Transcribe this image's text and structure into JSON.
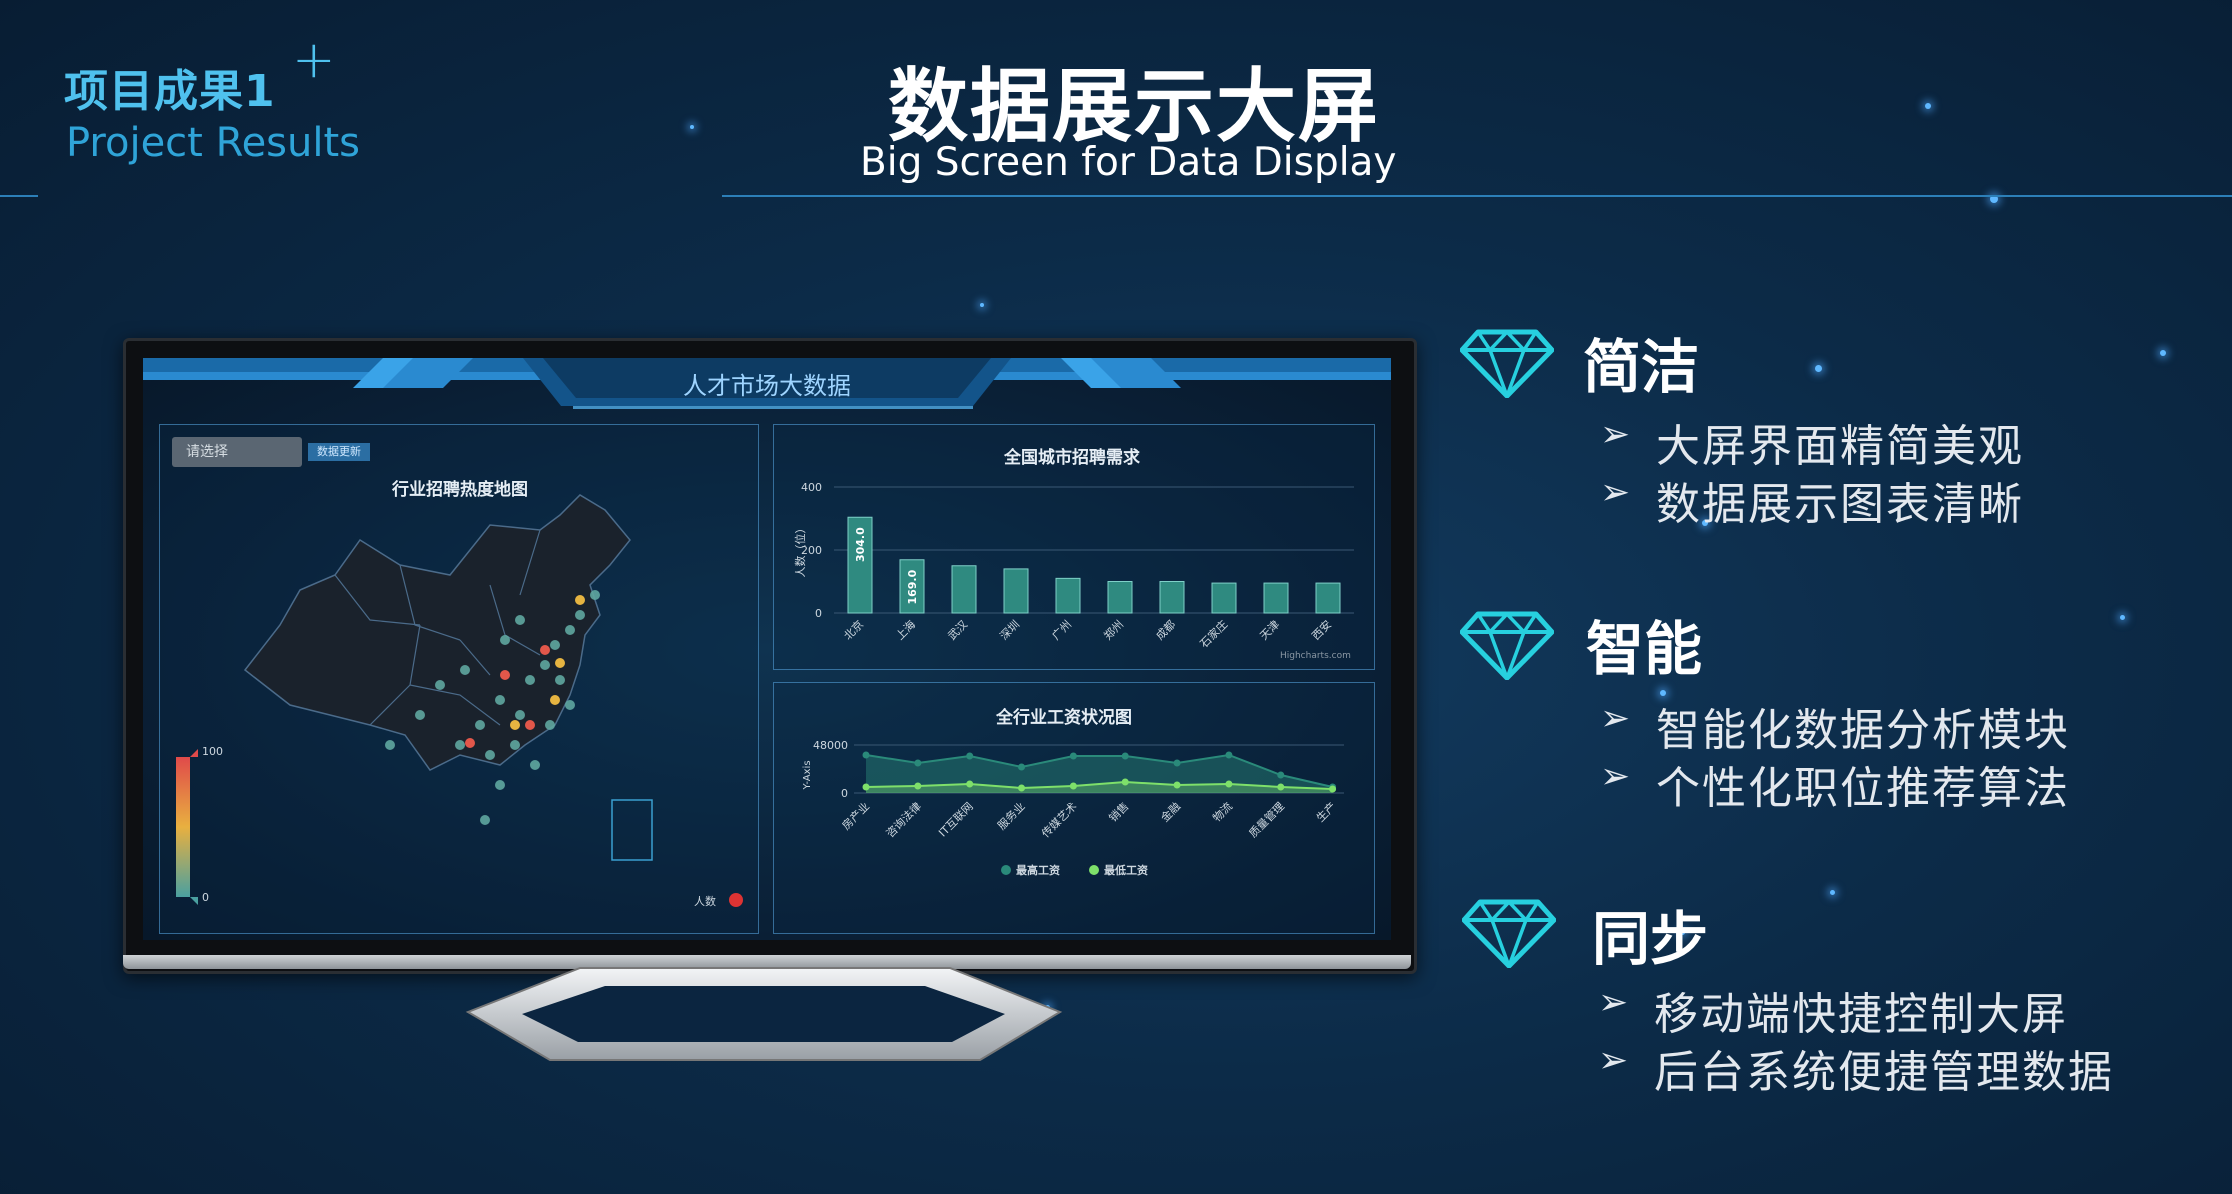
{
  "header": {
    "section_title": "项目成果1",
    "section_subtitle": "Project Results",
    "title": "数据展示大屏",
    "subtitle": "Big Screen for Data Display"
  },
  "dashboard": {
    "title": "人才市场大数据",
    "map_panel": {
      "select_placeholder": "请选择",
      "update_button": "数据更新",
      "title": "行业招聘热度地图",
      "scale_max": "100",
      "scale_min": "0",
      "legend_label": "人数"
    },
    "bar_panel": {
      "title": "全国城市招聘需求",
      "credit": "Highcharts.com"
    },
    "line_panel": {
      "title": "全行业工资状况图"
    }
  },
  "chart_data": [
    {
      "type": "bar",
      "title": "全国城市招聘需求",
      "ylabel": "人数（位）",
      "ylim": [
        0,
        400
      ],
      "yticks": [
        "400",
        "200",
        "0"
      ],
      "categories": [
        "北京",
        "上海",
        "武汉",
        "深圳",
        "广州",
        "郑州",
        "成都",
        "石家庄",
        "天津",
        "西安"
      ],
      "values": [
        304,
        169,
        150,
        140,
        110,
        100,
        100,
        95,
        95,
        95
      ],
      "data_labels": [
        "304.0",
        "169.0"
      ],
      "color": "#2f8a80"
    },
    {
      "type": "area",
      "title": "全行业工资状况图",
      "ylabel": "Y-Axis",
      "ylim": [
        0,
        48000
      ],
      "yticks": [
        "48000",
        "0"
      ],
      "categories": [
        "房产业",
        "咨询法律",
        "IT互联网",
        "服务业",
        "传媒艺术",
        "销售",
        "金融",
        "物流",
        "质量管理",
        "生产"
      ],
      "series": [
        {
          "name": "最高工资",
          "values": [
            38000,
            30000,
            37000,
            26000,
            37000,
            37000,
            30000,
            38000,
            18000,
            6000
          ],
          "color": "#2a8a7a"
        },
        {
          "name": "最低工资",
          "values": [
            6000,
            7000,
            9000,
            5000,
            7000,
            11000,
            8000,
            9000,
            6000,
            4000
          ],
          "color": "#7ee06a"
        }
      ]
    }
  ],
  "features": [
    {
      "head": "简洁",
      "items": [
        "大屏界面精简美观",
        "数据展示图表清晰"
      ]
    },
    {
      "head": "智能",
      "items": [
        "智能化数据分析模块",
        "个性化职位推荐算法"
      ]
    },
    {
      "head": "同步",
      "items": [
        "移动端快捷控制大屏",
        "后台系统便捷管理数据"
      ]
    }
  ],
  "colors": {
    "accent": "#4fc1ee",
    "gem": "#27d0df",
    "background": "#0c2b48"
  }
}
